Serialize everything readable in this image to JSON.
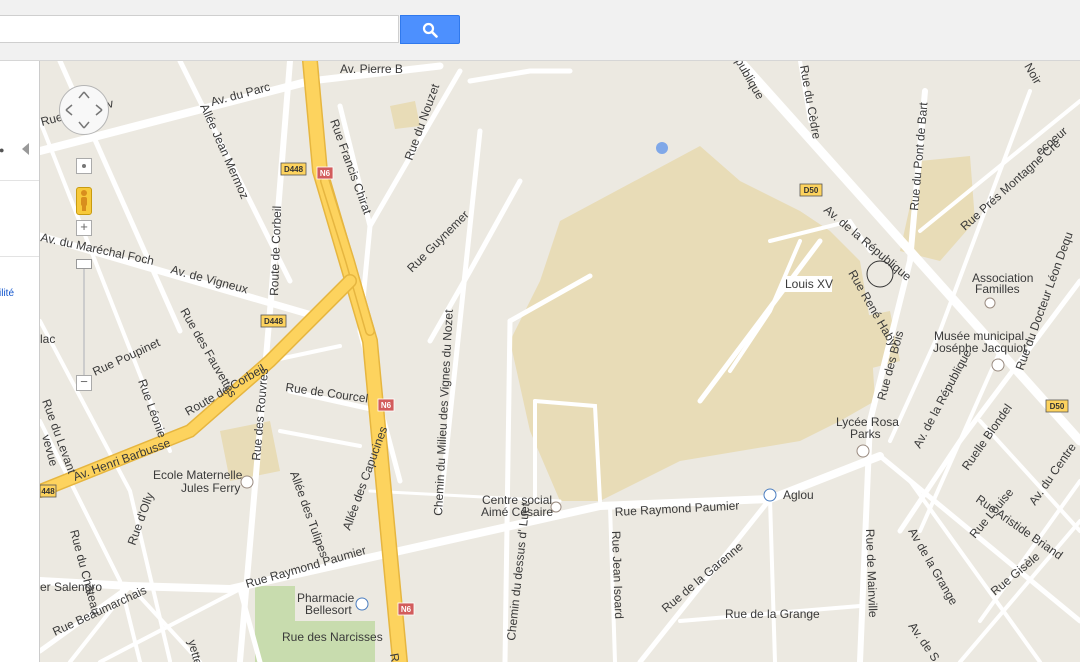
{
  "search": {
    "placeholder": "",
    "button_icon": "search-icon"
  },
  "left_panel": {
    "link_text": "ilité",
    "collapse_icon": "chevron-left-icon"
  },
  "map_controls": {
    "pan": "pan-control",
    "zoom_in": "+",
    "zoom_out": "−",
    "pegman": "pegman-icon",
    "zoom_level_fraction": 0.11
  },
  "streets": {
    "av_pierre": "Av. Pierre B",
    "av_parc": "Av. du Parc",
    "allee_mermoz": "Allée Jean Mermoz",
    "rue_fauvettes_top": "Rue des Fauv",
    "rue_francis": "Rue Francis Chirat",
    "rue_nouzet": "Rue du Nouzet",
    "av_republique_top": "publique",
    "rue_cedre": "Rue du Cèdre",
    "rue_pont_bart": "Rue du Pont de Bart",
    "rue_pres": "Rue Prés Montagne Crè",
    "rue_ecoeur": "ecoeur",
    "rue_noir": "Noir",
    "av_marechal": "Av. du Maréchal Foch",
    "av_vigneux": "Av. de Vigneux",
    "route_corbeil_v": "Route de Corbeil",
    "rue_guynemer": "Rue Guynemer",
    "av_republique": "Av. de la République",
    "rue_rene_haby": "Rue René Haby",
    "rue_fauvettes": "Rue des Fauvettes",
    "rue_poupinet": "Rue Poupinet",
    "rue_leonie": "Rue Léonie",
    "route_corbeil": "Route de Corbeil",
    "rue_courcel": "Rue de Courcel",
    "chemin_milieu": "Chemin du Milieu des Vignes du Nozet",
    "rue_bois": "Rue des Bois",
    "av_republique2": "Av. de la République",
    "rue_docteur": "Rue du Docteur Léon Dequ",
    "av_henri": "Av. Henri Barbusse",
    "rue_levant": "Rue du Levant",
    "rue_rouvres": "Rue des Rouvres",
    "allee_tulipes": "Allée des Tulipes",
    "allee_capucines": "Allée des Capucines",
    "rue_raymond": "Rue Raymond Paumier",
    "rue_raymond2": "Rue Raymond Paumier",
    "ruelle_blondel": "Ruelle Blondel",
    "rue_louise": "Rue Louise",
    "rue_aristide": "Rue Aristide Briand",
    "av_centre": "Av. du Centre",
    "rue_chateau": "Rue du Château",
    "rue_olly": "Rue d'Olly",
    "salengro": "er Salengro",
    "rue_beaumarchais": "Rue Beaumarchais",
    "chemin_dessus": "Chemin du dessus d' Luet",
    "rue_jean_isoard": "Rue Jean Isoard",
    "rue_garenne": "Rue de la Garenne",
    "rue_grange": "Rue de la Grange",
    "rue_mainville": "Rue de Mainville",
    "av_grange": "Av de la Grange",
    "rue_gisele": "Rue Gisèle",
    "rue_narcisses": "Rue des Narcisses",
    "vevue": "vevue",
    "lac": "lac",
    "yette": "yette",
    "r": "R",
    "av_s": "Av. de S"
  },
  "shields": {
    "d448_a": "D448",
    "n6_a": "N6",
    "d50_a": "D50",
    "d448_b": "D448",
    "n6_b": "N6",
    "d50_b": "D50",
    "d448_c": "448",
    "n6_c": "N6"
  },
  "pois": {
    "louis_xv": "Louis XV",
    "association_1": "Association",
    "association_2": "Familles",
    "musee_1": "Musée municipal",
    "musee_2": "Joséphe Jacquiot",
    "lycee_1": "Lycée Rosa",
    "lycee_2": "Parks",
    "ecole_1": "Ecole Maternelle",
    "ecole_2": "Jules Ferry",
    "centre_1": "Centre social",
    "centre_2": "Aimé Césaire",
    "aglou": "Aglou",
    "pharmacie_1": "Pharmacie",
    "pharmacie_2": "Bellesort"
  },
  "colors": {
    "land": "#ece9e1",
    "park": "#e8dcb7",
    "green": "#c8dcae",
    "road": "#ffffff",
    "highway": "#fdd35e",
    "highway_edge": "#e6b640",
    "search_button": "#4d90fe"
  }
}
